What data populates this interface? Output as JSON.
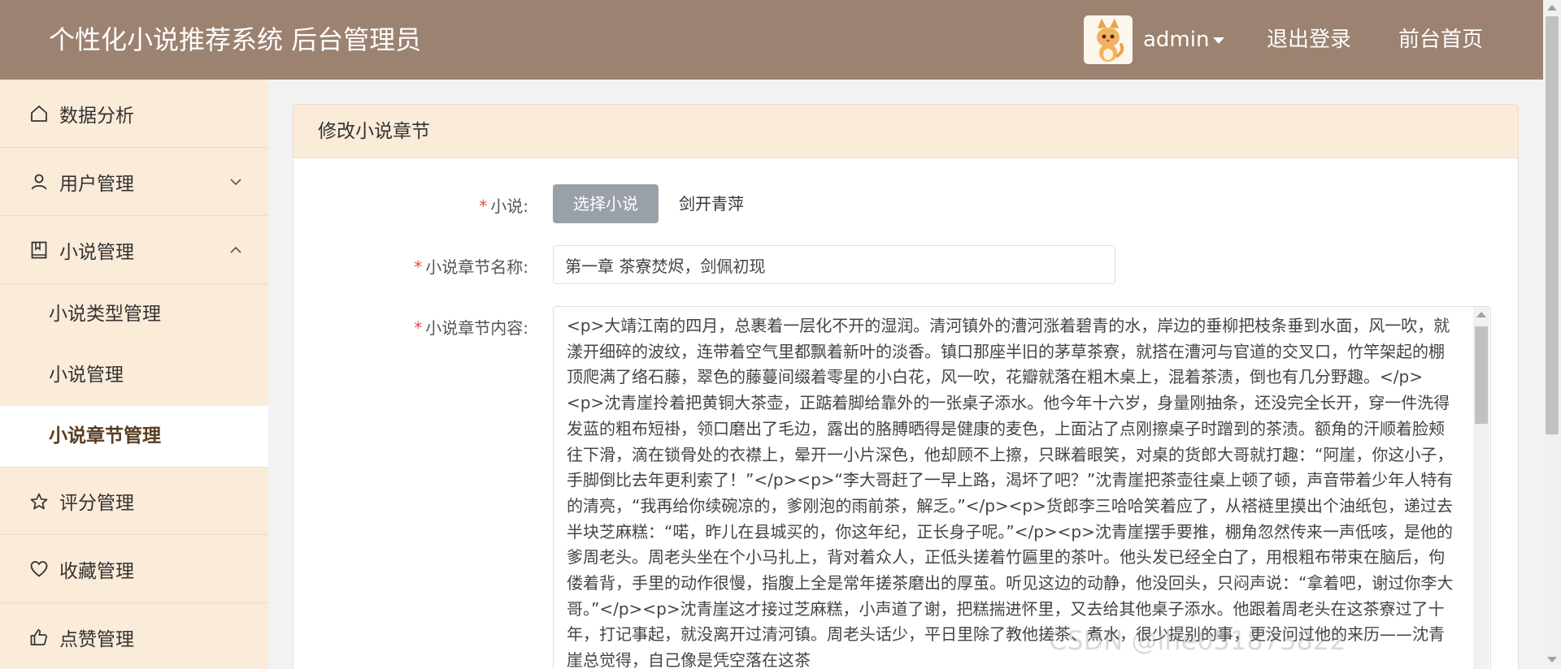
{
  "header": {
    "title": "个性化小说推荐系统 后台管理员",
    "username": "admin",
    "logout_label": "退出登录",
    "home_label": "前台首页",
    "bg_color": "#9c8270"
  },
  "sidebar": {
    "items": [
      {
        "label": "数据分析",
        "icon": "home-icon"
      },
      {
        "label": "用户管理",
        "icon": "user-icon",
        "expanded": false
      },
      {
        "label": "小说管理",
        "icon": "book-icon",
        "expanded": true
      },
      {
        "label": "评分管理",
        "icon": "star-icon"
      },
      {
        "label": "收藏管理",
        "icon": "heart-icon"
      },
      {
        "label": "点赞管理",
        "icon": "thumbs-up-icon"
      }
    ],
    "subitems": [
      {
        "label": "小说类型管理"
      },
      {
        "label": "小说管理"
      },
      {
        "label": "小说章节管理",
        "active": true
      }
    ]
  },
  "page": {
    "title": "修改小说章节"
  },
  "form": {
    "novel_label": "小说:",
    "select_button": "选择小说",
    "selected_novel": "剑开青萍",
    "chapter_name_label": "小说章节名称:",
    "chapter_name_value": "第一章 茶寮焚烬，剑佩初现",
    "chapter_content_label": "小说章节内容:",
    "chapter_content_value": "<p>大靖江南的四月，总裹着一层化不开的湿润。清河镇外的漕河涨着碧青的水，岸边的垂柳把枝条垂到水面，风一吹，就漾开细碎的波纹，连带着空气里都飘着新叶的淡香。镇口那座半旧的茅草茶寮，就搭在漕河与官道的交叉口，竹竿架起的棚顶爬满了络石藤，翠色的藤蔓间缀着零星的小白花，风一吹，花瓣就落在粗木桌上，混着茶渍，倒也有几分野趣。</p><p>沈青崖拎着把黄铜大茶壶，正踮着脚给靠外的一张桌子添水。他今年十六岁，身量刚抽条，还没完全长开，穿一件洗得发蓝的粗布短褂，领口磨出了毛边，露出的胳膊晒得是健康的麦色，上面沾了点刚擦桌子时蹭到的茶渍。额角的汗顺着脸颊往下滑，滴在锁骨处的衣襟上，晕开一小片深色，他却顾不上擦，只眯着眼笑，对桌的货郎大哥就打趣：“阿崖，你这小子，手脚倒比去年更利索了！”</p><p>“李大哥赶了一早上路，渴坏了吧？”沈青崖把茶壶往桌上顿了顿，声音带着少年人特有的清亮，“我再给你续碗凉的，爹刚泡的雨前茶，解乏。”</p><p>货郎李三哈哈笑着应了，从褡裢里摸出个油纸包，递过去半块芝麻糕：“喏，昨儿在县城买的，你这年纪，正长身子呢。”</p><p>沈青崖摆手要推，棚角忽然传来一声低咳，是他的爹周老头。周老头坐在个小马扎上，背对着众人，正低头搓着竹匾里的茶叶。他头发已经全白了，用根粗布带束在脑后，佝偻着背，手里的动作很慢，指腹上全是常年搓茶磨出的厚茧。听见这边的动静，他没回头，只闷声说：“拿着吧，谢过你李大哥。”</p><p>沈青崖这才接过芝麻糕，小声道了谢，把糕揣进怀里，又去给其他桌子添水。他跟着周老头在这茶寮过了十年，打记事起，就没离开过清河镇。周老头话少，平日里除了教他搓茶、煮水，很少提别的事，更没问过他的来历——沈青崖总觉得，自己像是凭空落在这茶"
  },
  "watermark": "CSDN @lhe051873822"
}
